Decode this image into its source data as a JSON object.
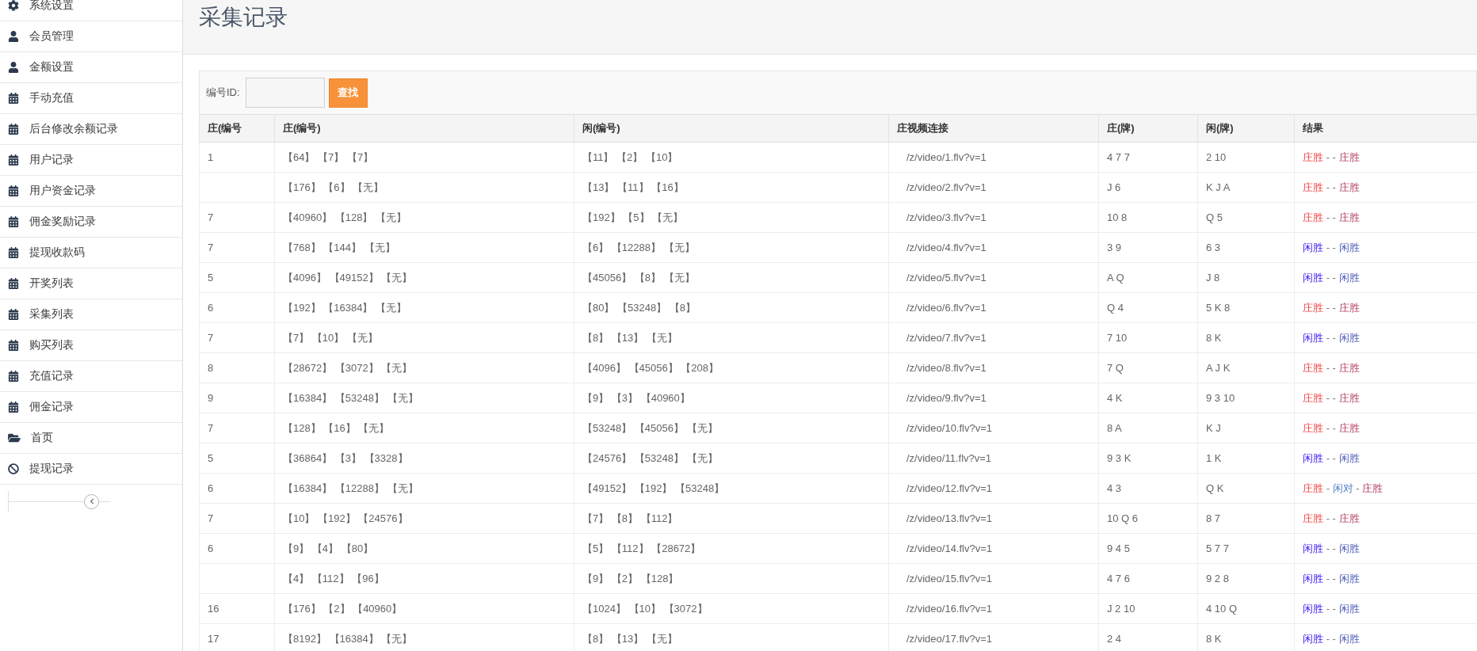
{
  "sidebar": {
    "items": [
      {
        "kind": "settings",
        "label": "系统设置"
      },
      {
        "kind": "user",
        "label": "会员管理"
      },
      {
        "kind": "user",
        "label": "金额设置"
      },
      {
        "kind": "calendar",
        "label": "手动充值"
      },
      {
        "kind": "calendar",
        "label": "后台修改余额记录"
      },
      {
        "kind": "calendar",
        "label": "用户记录"
      },
      {
        "kind": "calendar",
        "label": "用户资金记录"
      },
      {
        "kind": "calendar",
        "label": "佣金奖励记录"
      },
      {
        "kind": "calendar",
        "label": "提现收款码"
      },
      {
        "kind": "calendar",
        "label": "开奖列表"
      },
      {
        "kind": "calendar",
        "label": "采集列表"
      },
      {
        "kind": "calendar",
        "label": "购买列表"
      },
      {
        "kind": "calendar",
        "label": "充值记录"
      },
      {
        "kind": "calendar",
        "label": "佣金记录"
      },
      {
        "kind": "folder",
        "label": "首页"
      },
      {
        "kind": "ban",
        "label": "提现记录"
      }
    ]
  },
  "page": {
    "title": "采集记录"
  },
  "search": {
    "label": "编号ID:",
    "button": "查找"
  },
  "table": {
    "columns": [
      "庄(编号",
      "庄(编号)",
      "闲(编号)",
      "庄视频连接",
      "庄(牌)",
      "闲(牌)",
      "结果"
    ],
    "rows": [
      {
        "number": "1",
        "banker_numbers": "【64】 【7】 【7】",
        "player_numbers": "【11】 【2】 【10】",
        "video": "/z/video/1.flv?v=1",
        "banker_cards": "4 7 7",
        "player_cards": "2 10",
        "result": [
          {
            "kind": "banker",
            "text": "庄胜"
          },
          {
            "kind": "separator",
            "text": "- -"
          },
          {
            "kind": "banker_final",
            "text": "庄胜"
          }
        ]
      },
      {
        "banker_numbers": "【176】 【6】 【无】",
        "player_numbers": "【13】 【11】 【16】",
        "video": "/z/video/2.flv?v=1",
        "banker_cards": "J 6",
        "player_cards": "K J A",
        "result": [
          {
            "kind": "banker",
            "text": "庄胜"
          },
          {
            "kind": "separator",
            "text": "- -"
          },
          {
            "kind": "banker_final",
            "text": "庄胜"
          }
        ]
      },
      {
        "number": "7",
        "banker_numbers": "【40960】 【128】 【无】",
        "player_numbers": "【192】 【5】 【无】",
        "video": "/z/video/3.flv?v=1",
        "banker_cards": "10 8",
        "player_cards": "Q 5",
        "result": [
          {
            "kind": "banker",
            "text": "庄胜"
          },
          {
            "kind": "separator",
            "text": "- -"
          },
          {
            "kind": "banker_final",
            "text": "庄胜"
          }
        ]
      },
      {
        "number": "7",
        "banker_numbers": "【768】 【144】 【无】",
        "player_numbers": "【6】 【12288】 【无】",
        "video": "/z/video/4.flv?v=1",
        "banker_cards": "3 9",
        "player_cards": "6 3",
        "result": [
          {
            "kind": "player",
            "text": "闲胜"
          },
          {
            "kind": "separator",
            "text": "- -"
          },
          {
            "kind": "player_final",
            "text": "闲胜"
          }
        ]
      },
      {
        "number": "5",
        "banker_numbers": "【4096】 【49152】 【无】",
        "player_numbers": "【45056】 【8】 【无】",
        "video": "/z/video/5.flv?v=1",
        "banker_cards": "A Q",
        "player_cards": "J 8",
        "result": [
          {
            "kind": "player",
            "text": "闲胜"
          },
          {
            "kind": "separator",
            "text": "- -"
          },
          {
            "kind": "player_final",
            "text": "闲胜"
          }
        ]
      },
      {
        "number": "6",
        "banker_numbers": "【192】 【16384】 【无】",
        "player_numbers": "【80】 【53248】 【8】",
        "video": "/z/video/6.flv?v=1",
        "banker_cards": "Q 4",
        "player_cards": "5 K 8",
        "result": [
          {
            "kind": "banker",
            "text": "庄胜"
          },
          {
            "kind": "separator",
            "text": "- -"
          },
          {
            "kind": "banker_final",
            "text": "庄胜"
          }
        ]
      },
      {
        "number": "7",
        "banker_numbers": "【7】 【10】 【无】",
        "player_numbers": "【8】 【13】 【无】",
        "video": "/z/video/7.flv?v=1",
        "banker_cards": "7 10",
        "player_cards": "8 K",
        "result": [
          {
            "kind": "player",
            "text": "闲胜"
          },
          {
            "kind": "separator",
            "text": "- -"
          },
          {
            "kind": "player_final",
            "text": "闲胜"
          }
        ]
      },
      {
        "number": "8",
        "banker_numbers": "【28672】 【3072】 【无】",
        "player_numbers": "【4096】 【45056】 【208】",
        "video": "/z/video/8.flv?v=1",
        "banker_cards": "7 Q",
        "player_cards": "A J K",
        "result": [
          {
            "kind": "banker",
            "text": "庄胜"
          },
          {
            "kind": "separator",
            "text": "- -"
          },
          {
            "kind": "banker_final",
            "text": "庄胜"
          }
        ]
      },
      {
        "number": "9",
        "banker_numbers": "【16384】 【53248】 【无】",
        "player_numbers": "【9】 【3】 【40960】",
        "video": "/z/video/9.flv?v=1",
        "banker_cards": "4 K",
        "player_cards": "9 3 10",
        "result": [
          {
            "kind": "banker",
            "text": "庄胜"
          },
          {
            "kind": "separator",
            "text": "- -"
          },
          {
            "kind": "banker_final",
            "text": "庄胜"
          }
        ]
      },
      {
        "number": "7",
        "banker_numbers": "【128】 【16】 【无】",
        "player_numbers": "【53248】 【45056】 【无】",
        "video": "/z/video/10.flv?v=1",
        "banker_cards": "8 A",
        "player_cards": "K J",
        "result": [
          {
            "kind": "banker",
            "text": "庄胜"
          },
          {
            "kind": "separator",
            "text": "- -"
          },
          {
            "kind": "banker_final",
            "text": "庄胜"
          }
        ]
      },
      {
        "number": "5",
        "banker_numbers": "【36864】 【3】 【3328】",
        "player_numbers": "【24576】 【53248】 【无】",
        "video": "/z/video/11.flv?v=1",
        "banker_cards": "9 3 K",
        "player_cards": "1 K",
        "result": [
          {
            "kind": "player",
            "text": "闲胜"
          },
          {
            "kind": "separator",
            "text": "- -"
          },
          {
            "kind": "player_final",
            "text": "闲胜"
          }
        ]
      },
      {
        "number": "6",
        "banker_numbers": "【16384】 【12288】 【无】",
        "player_numbers": "【49152】 【192】 【53248】",
        "video": "/z/video/12.flv?v=1",
        "banker_cards": "4 3",
        "player_cards": "Q K",
        "result": [
          {
            "kind": "banker",
            "text": "庄胜"
          },
          {
            "kind": "separator",
            "text": "-"
          },
          {
            "kind": "pair",
            "text": "闲对"
          },
          {
            "kind": "separator",
            "text": "-"
          },
          {
            "kind": "banker_final",
            "text": "庄胜"
          }
        ]
      },
      {
        "number": "7",
        "banker_numbers": "【10】 【192】 【24576】",
        "player_numbers": "【7】 【8】 【112】",
        "video": "/z/video/13.flv?v=1",
        "banker_cards": "10 Q 6",
        "player_cards": "8 7",
        "result": [
          {
            "kind": "banker",
            "text": "庄胜"
          },
          {
            "kind": "separator",
            "text": "- -"
          },
          {
            "kind": "banker_final",
            "text": "庄胜"
          }
        ]
      },
      {
        "number": "6",
        "banker_numbers": "【9】 【4】 【80】",
        "player_numbers": "【5】 【112】 【28672】",
        "video": "/z/video/14.flv?v=1",
        "banker_cards": "9 4 5",
        "player_cards": "5 7 7",
        "result": [
          {
            "kind": "player",
            "text": "闲胜"
          },
          {
            "kind": "separator",
            "text": "- -"
          },
          {
            "kind": "player_final",
            "text": "闲胜"
          }
        ]
      },
      {
        "banker_numbers": "【4】 【112】 【96】",
        "player_numbers": "【9】 【2】 【128】",
        "video": "/z/video/15.flv?v=1",
        "banker_cards": "4 7 6",
        "player_cards": "9 2 8",
        "result": [
          {
            "kind": "player",
            "text": "闲胜"
          },
          {
            "kind": "separator",
            "text": "- -"
          },
          {
            "kind": "player_final",
            "text": "闲胜"
          }
        ]
      },
      {
        "number": "16",
        "banker_numbers": "【176】 【2】 【40960】",
        "player_numbers": "【1024】 【10】 【3072】",
        "video": "/z/video/16.flv?v=1",
        "banker_cards": "J 2 10",
        "player_cards": "4 10 Q",
        "result": [
          {
            "kind": "player",
            "text": "闲胜"
          },
          {
            "kind": "separator",
            "text": "- -"
          },
          {
            "kind": "player_final",
            "text": "闲胜"
          }
        ]
      },
      {
        "number": "17",
        "banker_numbers": "【8192】 【16384】 【无】",
        "player_numbers": "【8】 【13】 【无】",
        "video": "/z/video/17.flv?v=1",
        "banker_cards": "2 4",
        "player_cards": "8 K",
        "result": [
          {
            "kind": "player",
            "text": "闲胜"
          },
          {
            "kind": "separator",
            "text": "- -"
          },
          {
            "kind": "player_final",
            "text": "闲胜"
          }
        ]
      }
    ]
  }
}
